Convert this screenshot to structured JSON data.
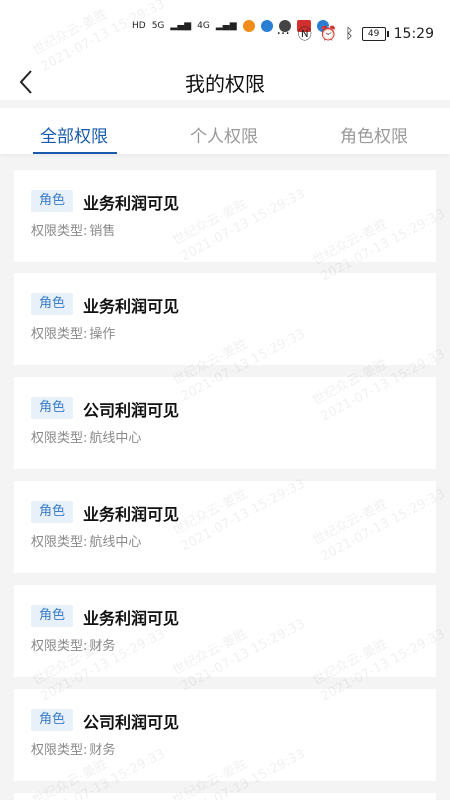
{
  "status_bar": {
    "time": "15:29",
    "battery": "49",
    "left_labels": [
      "HD",
      "5G",
      "4G"
    ]
  },
  "header": {
    "title": "我的权限"
  },
  "tabs": [
    {
      "label": "全部权限",
      "active": true
    },
    {
      "label": "个人权限",
      "active": false
    },
    {
      "label": "角色权限",
      "active": false
    }
  ],
  "cards": [
    {
      "badge": "角色",
      "title": "业务利润可见",
      "type_label": "权限类型:",
      "type_value": "销售"
    },
    {
      "badge": "角色",
      "title": "业务利润可见",
      "type_label": "权限类型:",
      "type_value": "操作"
    },
    {
      "badge": "角色",
      "title": "公司利润可见",
      "type_label": "权限类型:",
      "type_value": "航线中心"
    },
    {
      "badge": "角色",
      "title": "业务利润可见",
      "type_label": "权限类型:",
      "type_value": "航线中心"
    },
    {
      "badge": "角色",
      "title": "业务利润可见",
      "type_label": "权限类型:",
      "type_value": "财务"
    },
    {
      "badge": "角色",
      "title": "公司利润可见",
      "type_label": "权限类型:",
      "type_value": "财务"
    }
  ],
  "watermark": {
    "line1": "世纪众云-姜胜",
    "line2": "2021-07-13 15:29:33"
  },
  "colors": {
    "accent": "#1a5cab",
    "badge_text": "#3b7ec9",
    "badge_bg": "#e8f0fa",
    "page_bg": "#f4f4f4"
  }
}
